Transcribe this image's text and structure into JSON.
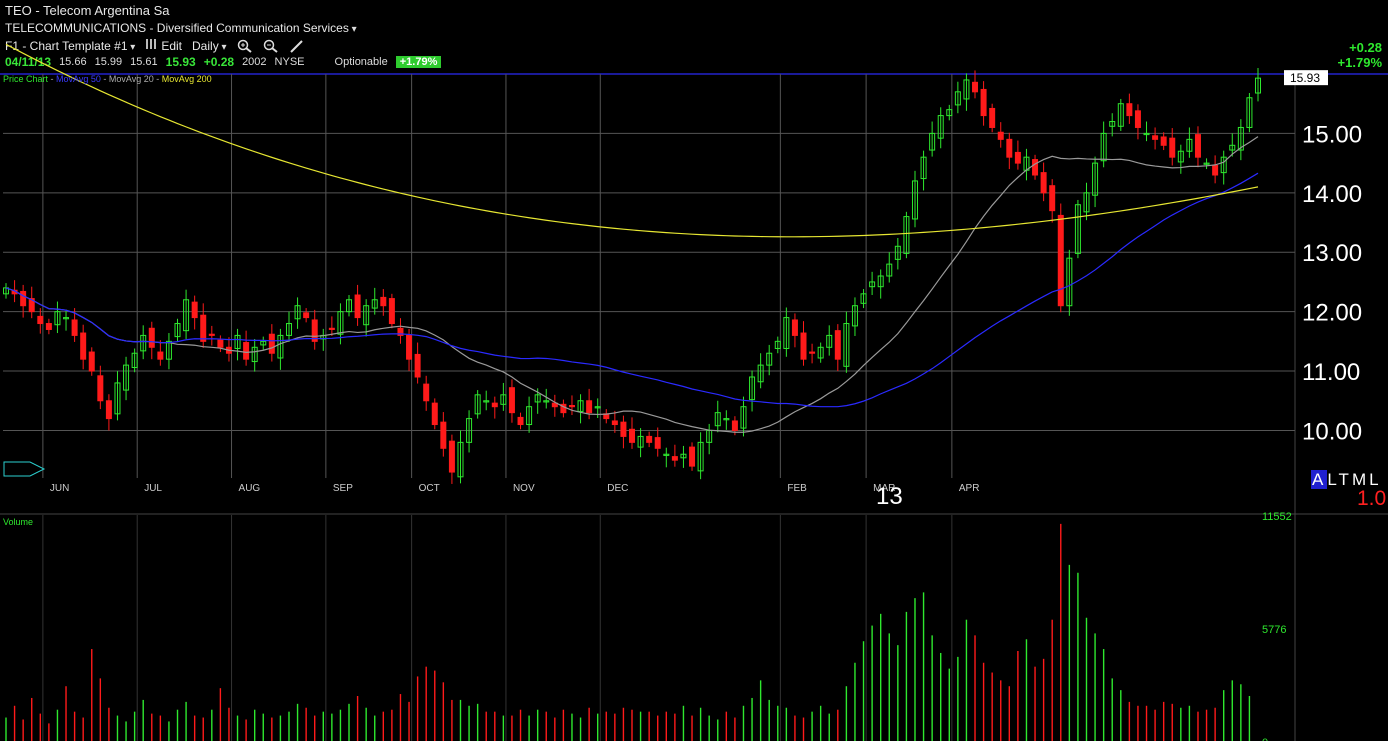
{
  "header": {
    "title": "TEO - Telecom Argentina Sa",
    "sector": "TELECOMMUNICATIONS - Diversified Communication Services",
    "template": "F1 - Chart Template #1",
    "edit": "Edit",
    "period": "Daily",
    "quote": {
      "date": "04/11/13",
      "open": "15.66",
      "high": "15.99",
      "low": "15.61",
      "last": "15.93",
      "change": "+0.28",
      "volume": "2002",
      "exchange": "NYSE",
      "optionable": "Optionable",
      "pct": "+1.79%"
    },
    "right_change": "+0.28",
    "right_pct": "+1.79%"
  },
  "legend": {
    "price": "Price Chart",
    "ma50": "MovAvg 50",
    "ma20": "MovAvg 20",
    "ma200": "MovAvg 200"
  },
  "volume_label": "Volume",
  "timeframes": {
    "a": "A",
    "l": "L",
    "t": "T",
    "m": "M",
    "l2": "L"
  },
  "version": "1.0",
  "year_label": "13",
  "colors": {
    "up": "#2ee82e",
    "down": "#ff1a1a",
    "ma50": "#2a2aff",
    "ma20": "#9a9a9a",
    "ma200": "#e6e632",
    "grid": "#555555"
  },
  "chart_data": [
    {
      "type": "candlestick",
      "title": "TEO - Telecom Argentina Sa",
      "categories": [
        "JUN",
        "JUL",
        "AUG",
        "SEP",
        "OCT",
        "NOV",
        "DEC",
        "FEB",
        "MAR",
        "APR"
      ],
      "y_ticks": [
        "10.00",
        "11.00",
        "12.00",
        "13.00",
        "14.00",
        "15.00"
      ],
      "ylim": [
        9.2,
        16.0
      ],
      "last_price_label": "15.93",
      "series_close": [
        12.4,
        12.3,
        12.1,
        12.0,
        11.8,
        11.7,
        12.0,
        11.9,
        11.6,
        11.2,
        11.0,
        10.5,
        10.2,
        10.8,
        11.1,
        11.3,
        11.6,
        11.4,
        11.2,
        11.5,
        11.8,
        12.2,
        11.9,
        11.5,
        11.6,
        11.4,
        11.3,
        11.6,
        11.2,
        11.4,
        11.5,
        11.3,
        11.6,
        11.8,
        12.1,
        11.9,
        11.5,
        11.6,
        11.7,
        12.0,
        12.2,
        11.9,
        12.1,
        12.2,
        12.1,
        11.8,
        11.6,
        11.2,
        10.9,
        10.5,
        10.1,
        9.7,
        9.3,
        9.8,
        10.2,
        10.6,
        10.5,
        10.4,
        10.6,
        10.3,
        10.1,
        10.4,
        10.6,
        10.5,
        10.4,
        10.3,
        10.4,
        10.5,
        10.3,
        10.4,
        10.2,
        10.1,
        9.9,
        9.8,
        9.9,
        9.8,
        9.7,
        9.6,
        9.5,
        9.6,
        9.4,
        9.8,
        10.0,
        10.3,
        10.2,
        10.0,
        10.4,
        10.9,
        11.1,
        11.3,
        11.5,
        11.9,
        11.6,
        11.2,
        11.3,
        11.4,
        11.6,
        11.2,
        11.8,
        12.1,
        12.3,
        12.5,
        12.6,
        12.8,
        13.1,
        13.6,
        14.2,
        14.6,
        15.0,
        15.3,
        15.4,
        15.7,
        15.9,
        15.7,
        15.3,
        15.1,
        14.9,
        14.6,
        14.5,
        14.6,
        14.3,
        14.0,
        13.7,
        12.1,
        12.9,
        13.8,
        14.0,
        14.5,
        15.0,
        15.2,
        15.5,
        15.3,
        15.1,
        15.0,
        14.9,
        14.8,
        14.6,
        14.7,
        14.9,
        14.6,
        14.5,
        14.3,
        14.6,
        14.8,
        15.1,
        15.6,
        15.93
      ],
      "moving_averages": [
        "MovAvg 50",
        "MovAvg 20",
        "MovAvg 200"
      ]
    },
    {
      "type": "bar",
      "title": "Volume",
      "y_ticks": [
        "11552",
        "5776",
        "0"
      ],
      "ylim": [
        0,
        11552
      ],
      "values": [
        1200,
        1800,
        1100,
        2200,
        1400,
        900,
        1600,
        2800,
        1500,
        1200,
        4700,
        3200,
        1700,
        1300,
        1000,
        1500,
        2100,
        1400,
        1300,
        1000,
        1600,
        2000,
        1300,
        1200,
        1600,
        2700,
        1700,
        1300,
        1100,
        1600,
        1400,
        1200,
        1300,
        1500,
        1900,
        1700,
        1300,
        1500,
        1400,
        1600,
        1900,
        2300,
        1700,
        1300,
        1500,
        1600,
        2400,
        2000,
        3300,
        3800,
        3600,
        3000,
        2100,
        2100,
        1800,
        1900,
        1500,
        1500,
        1300,
        1300,
        1600,
        1300,
        1600,
        1500,
        1200,
        1600,
        1400,
        1200,
        1700,
        1400,
        1500,
        1400,
        1700,
        1600,
        1500,
        1500,
        1300,
        1500,
        1400,
        1800,
        1300,
        1700,
        1300,
        1100,
        1500,
        1200,
        1800,
        2200,
        3100,
        2100,
        1800,
        1700,
        1300,
        1200,
        1500,
        1800,
        1400,
        1600,
        2800,
        4000,
        5100,
        5900,
        6500,
        5500,
        4900,
        6600,
        7300,
        7600,
        5400,
        4500,
        3700,
        4300,
        6200,
        5400,
        4000,
        3500,
        3100,
        2800,
        4600,
        5200,
        3800,
        4200,
        6200,
        11100,
        9000,
        8600,
        6300,
        5500,
        4700,
        3200,
        2600,
        2000,
        1800,
        1800,
        1600,
        2000,
        1900,
        1700,
        1800,
        1500,
        1600,
        1700,
        2600,
        3100,
        2900,
        2300
      ]
    }
  ]
}
